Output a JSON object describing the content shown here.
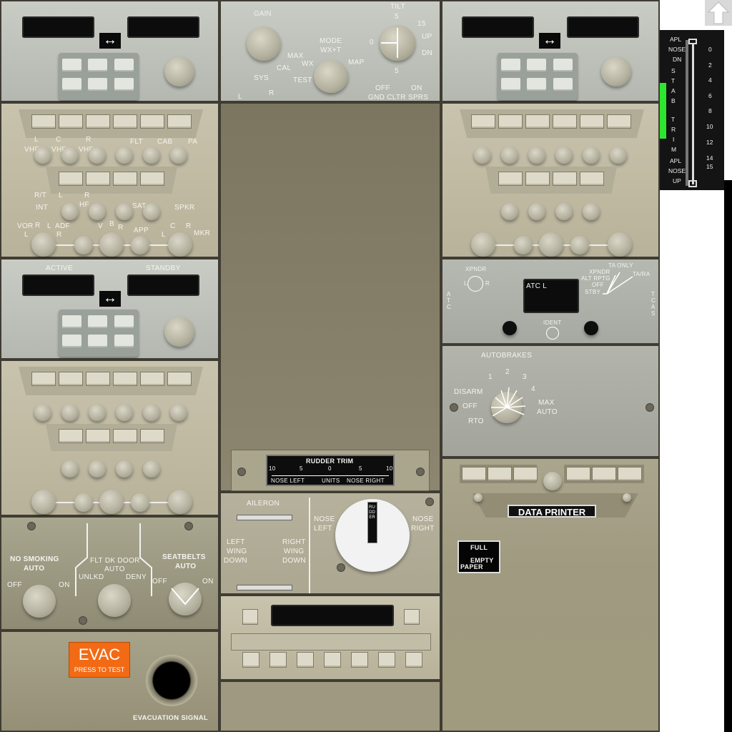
{
  "weather_radar": {
    "gain_label": "GAIN",
    "tilt_label": "TILT",
    "tilt_top": "5",
    "tilt_bottom": "5",
    "tilt_zero": "0",
    "fifteen": "15",
    "up": "UP",
    "dn": "DN",
    "mode_label": "MODE",
    "mode_options": [
      "WX+T",
      "MAX",
      "CAL",
      "WX",
      "TEST",
      "MAP",
      "SYS",
      "L",
      "R"
    ],
    "gnd_cltr_label": "OFF",
    "gnd_cltr_on": "ON",
    "gnd_cltr_text": "GND CLTR SPRS"
  },
  "radio_top_left": {
    "swap": "↔"
  },
  "radio_top_right": {
    "swap": "↔"
  },
  "audio_left": {
    "row1": [
      "L",
      "C",
      "R",
      "FLT",
      "CAB",
      "PA"
    ],
    "row1b": [
      "VHF",
      "VHF",
      "VHF"
    ],
    "rt": "R/T",
    "int": "INT",
    "hf": [
      "L",
      "R",
      "HF"
    ],
    "sat": "SAT",
    "spkr": "SPKR",
    "vor": "VOR",
    "vor_lr": [
      "L",
      "R"
    ],
    "adf": "ADF",
    "adf_lr": [
      "L",
      "R"
    ],
    "vbr": [
      "V",
      "B",
      "R"
    ],
    "app": "APP",
    "mkr_lcr": [
      "L",
      "C",
      "R"
    ],
    "mkr": "MKR"
  },
  "radio_mid_left": {
    "active": "ACTIVE",
    "standby": "STANDBY",
    "swap": "↔"
  },
  "atc": {
    "xpndr": "XPNDR",
    "l": "L",
    "r": "R",
    "atc_side": "ATC",
    "display": "ATC L",
    "ident": "IDENT",
    "tcas_side": "TCAS",
    "modes": [
      "TA ONLY",
      "TA/RA",
      "XPNDR",
      "ALT RPTG",
      "OFF",
      "STBY"
    ]
  },
  "autobrakes": {
    "title": "AUTOBRAKES",
    "settings": [
      "1",
      "2",
      "3",
      "4",
      "DISARM",
      "OFF",
      "RTO",
      "MAX",
      "AUTO"
    ]
  },
  "rudder_trim": {
    "title": "RUDDER TRIM",
    "scale": [
      "10",
      "5",
      "0",
      "5",
      "10"
    ],
    "nose_left": "NOSE LEFT",
    "units": "UNITS",
    "nose_right": "NOSE RIGHT",
    "knob_label": "RUDDER",
    "knob_nose_left": [
      "NOSE",
      "LEFT"
    ],
    "knob_nose_right": [
      "NOSE",
      "RIGHT"
    ]
  },
  "aileron": {
    "title": "AILERON",
    "left": [
      "LEFT",
      "WING",
      "DOWN"
    ],
    "right": [
      "RIGHT",
      "WING",
      "DOWN"
    ]
  },
  "data_printer": {
    "title": "DATA PRINTER",
    "full": "FULL",
    "empty": "EMPTY",
    "paper": "PAPER"
  },
  "signs": {
    "no_smoking": [
      "NO SMOKING",
      "AUTO"
    ],
    "ns_off": "OFF",
    "ns_on": "ON",
    "flt_dk_door": [
      "FLT DK DOOR",
      "AUTO"
    ],
    "unlkd": "UNLKD",
    "deny": "DENY",
    "seatbelts": [
      "SEATBELTS",
      "AUTO"
    ],
    "sb_off": "OFF",
    "sb_on": "ON"
  },
  "evac": {
    "button": "EVAC",
    "sub": "PRESS TO TEST",
    "signal": "EVACUATION SIGNAL"
  },
  "stab_trim": {
    "apl_nose_dn": [
      "APL",
      "NOSE",
      "DN"
    ],
    "vertical": [
      "S",
      "T",
      "A",
      "B",
      "",
      "T",
      "R",
      "I",
      "M"
    ],
    "apl_nose_up": [
      "APL",
      "NOSE",
      "UP"
    ],
    "scale": [
      "0",
      "2",
      "4",
      "6",
      "8",
      "10",
      "12",
      "14",
      "15"
    ],
    "green_band_color": "#2ee62e"
  }
}
